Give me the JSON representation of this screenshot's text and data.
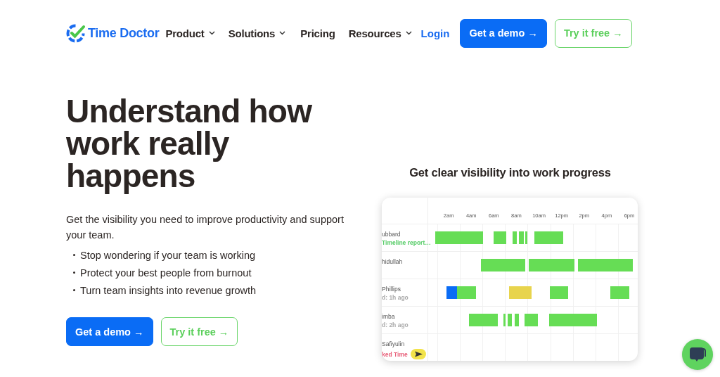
{
  "header": {
    "logo": "Time Doctor",
    "nav": [
      {
        "label": "Product",
        "dropdown": true
      },
      {
        "label": "Solutions",
        "dropdown": true
      },
      {
        "label": "Pricing",
        "dropdown": false
      },
      {
        "label": "Resources",
        "dropdown": true
      }
    ],
    "login": "Login",
    "buttons": [
      {
        "label": "Get a demo →",
        "kind": "primary"
      },
      {
        "label": "Try it free →",
        "kind": "outline"
      }
    ]
  },
  "hero": {
    "heading": [
      "Understand how",
      "work really",
      "happens"
    ],
    "intro": "Get the visibility you need to improve productivity and support your team.",
    "bullets": [
      "Stop wondering if your team is working",
      "Protect your best people from burnout",
      "Turn team insights into revenue growth"
    ],
    "buttons": [
      {
        "label": "Get a demo →",
        "kind": "primary"
      },
      {
        "label": "Try it free →",
        "kind": "outline"
      }
    ]
  },
  "timeline": {
    "title": "Get clear visibility into work progress",
    "hours": [
      "2am",
      "4am",
      "6am",
      "8am",
      "10am",
      "12pm",
      "2pm",
      "4pm",
      "6pm"
    ],
    "rows": [
      {
        "name": "ubbard",
        "note": {
          "text": "Timeline report…",
          "color": "#55cc66"
        },
        "segments": [
          {
            "color": "#66dd55"
          },
          {
            "color": "#66dd55"
          },
          {
            "color": "#66dd55"
          },
          {
            "color": "#66dd55"
          },
          {
            "color": "#66dd55"
          },
          {
            "color": "#66dd55"
          }
        ]
      },
      {
        "name": "hidullah",
        "segments": [
          {
            "color": "#66dd55"
          },
          {
            "color": "#66dd55"
          },
          {
            "color": "#66dd55"
          }
        ]
      },
      {
        "name": "Phillips",
        "note": {
          "text": "d: 1h ago",
          "color": "#aaaaaa"
        },
        "segments": [
          {
            "color": "#0a6cf5"
          },
          {
            "color": "#66dd55"
          },
          {
            "color": "#e8d44d"
          },
          {
            "color": "#66dd55"
          },
          {
            "color": "#66dd55"
          }
        ]
      },
      {
        "name": "imba",
        "note": {
          "text": "d: 2h ago",
          "color": "#aaaaaa"
        },
        "segments": [
          {
            "color": "#66dd55"
          },
          {
            "color": "#66dd55"
          },
          {
            "color": "#66dd55"
          },
          {
            "color": "#66dd55"
          },
          {
            "color": "#66dd55"
          },
          {
            "color": "#66dd55"
          }
        ]
      },
      {
        "name": "Safiyulin",
        "note": {
          "text": "ked Time",
          "color": "#e8607a"
        },
        "badge": true,
        "segments": []
      }
    ]
  }
}
